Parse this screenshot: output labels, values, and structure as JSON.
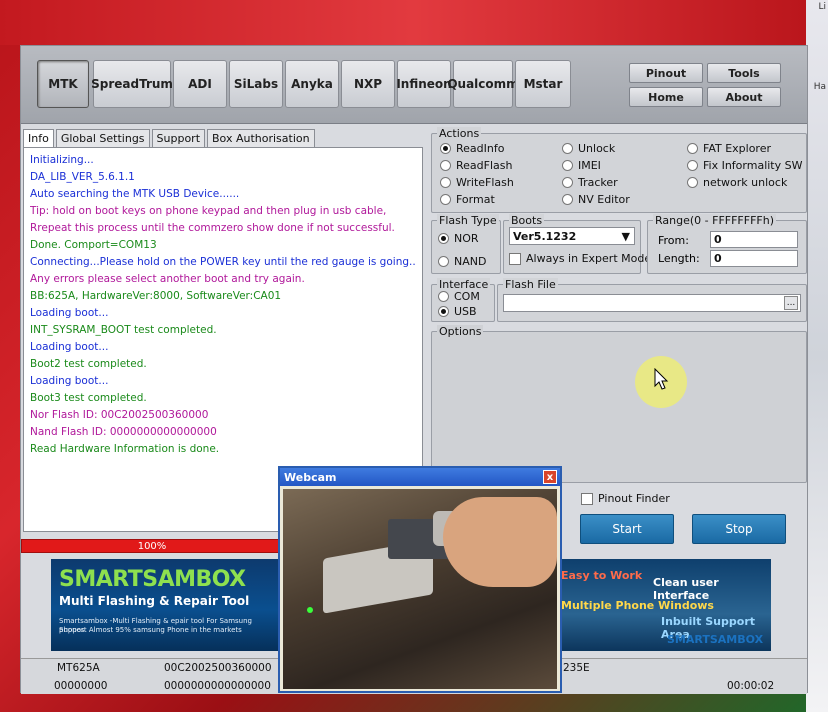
{
  "toolbar": {
    "tabs": [
      "MTK",
      "SpreadTrum",
      "ADI",
      "SiLabs",
      "Anyka",
      "NXP",
      "Infineon",
      "Qualcomm",
      "Mstar"
    ],
    "buttons": {
      "pinout": "Pinout",
      "tools": "Tools",
      "home": "Home",
      "about": "About"
    }
  },
  "info_tabs": [
    "Info",
    "Global Settings",
    "Support",
    "Box Authorisation"
  ],
  "log": [
    "Initializing...",
    "DA_LIB_VER_5.6.1.1",
    "Auto searching the MTK USB Device......",
    "Tip: hold on boot keys on phone keypad and then plug in usb cable,",
    "Rrepeat this process until the commzero show done if not successful.",
    "Done. Comport=COM13",
    "Connecting...Please hold on the POWER key until the red gauge is going...",
    "Any errors please select another boot and try again.",
    "BB:625A,   HardwareVer:8000,   SoftwareVer:CA01",
    "Loading boot...",
    "INT_SYSRAM_BOOT test completed.",
    "Loading boot...",
    "Boot2 test completed.",
    "Loading boot...",
    "Boot3 test completed.",
    "Nor Flash ID: 00C2002500360000",
    "Nand Flash ID: 0000000000000000",
    "Read Hardware Information is done."
  ],
  "log_colors": [
    "#1a2fd6",
    "#1a2fd6",
    "#1a2fd6",
    "#b0189a",
    "#b0189a",
    "#1a8a1a",
    "#1a2fd6",
    "#b0189a",
    "#1a8a1a",
    "#1a2fd6",
    "#1a8a1a",
    "#1a2fd6",
    "#1a8a1a",
    "#1a2fd6",
    "#1a8a1a",
    "#b0189a",
    "#b0189a",
    "#1a8a1a"
  ],
  "progress": {
    "label": "100%",
    "value": 100
  },
  "actions": {
    "legend": "Actions",
    "col1": [
      "ReadInfo",
      "ReadFlash",
      "WriteFlash",
      "Format"
    ],
    "col2": [
      "Unlock",
      "IMEI",
      "Tracker",
      "NV Editor"
    ],
    "col3": [
      "FAT Explorer",
      "Fix Informality SW",
      "network unlock"
    ],
    "selected": "ReadInfo"
  },
  "flash_type": {
    "legend": "Flash Type",
    "options": [
      "NOR",
      "NAND"
    ],
    "selected": "NOR"
  },
  "boots": {
    "legend": "Boots",
    "value": "Ver5.1232",
    "checkbox": "Always in Expert Mode"
  },
  "range": {
    "legend": "Range(0 - FFFFFFFFh)",
    "from_label": "From:",
    "from_value": "0",
    "length_label": "Length:",
    "length_value": "0"
  },
  "interface": {
    "legend": "Interface",
    "options": [
      "COM",
      "USB"
    ],
    "selected": "USB"
  },
  "flash_file": {
    "legend": "Flash File",
    "browse": "..."
  },
  "options": {
    "legend": "Options"
  },
  "pinout_finder": "Pinout Finder",
  "start": "Start",
  "stop": "Stop",
  "banner": {
    "logo": "SMARTSAMBOX",
    "subtitle": "Multi Flashing & Repair Tool",
    "line1": "Smartsambox -Multi Flashing & epair tool For Samsung phones",
    "line2": "Support Almost 95% samsung  Phone in the markets"
  },
  "banner2": {
    "t1": "Easy to Work",
    "t2": "Clean user Interface",
    "t3": "Multiple Phone Windows",
    "t4": "Inbuilt Support Area",
    "t5": "SMARTSAMBOX"
  },
  "status": {
    "r1c1": "MT625A",
    "r1c2": "00C2002500360000",
    "r1c3": "235E",
    "r2c1": "00000000",
    "r2c2": "0000000000000000",
    "r2c3": "00:00:02"
  },
  "webcam": {
    "title": "Webcam",
    "close": "x"
  },
  "right_edge": {
    "a": "Li",
    "b": "Ha"
  }
}
